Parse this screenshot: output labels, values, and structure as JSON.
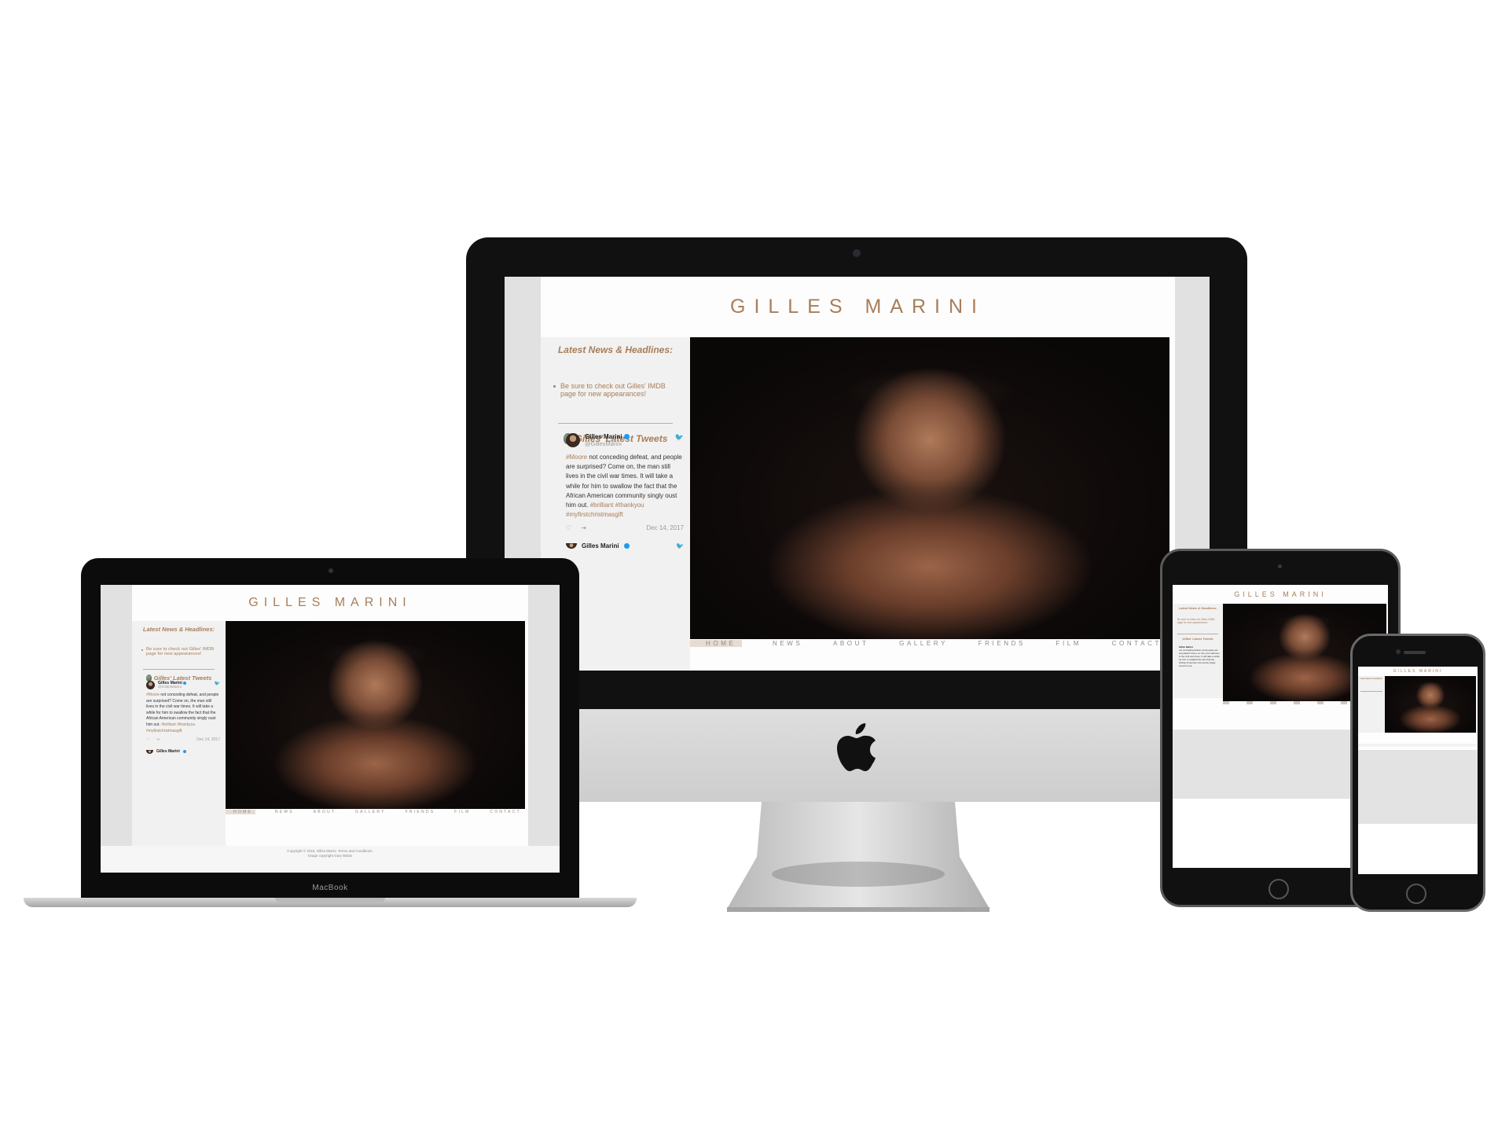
{
  "site": {
    "title": "GILLES MARINI",
    "news_heading": "Latest News & Headlines:",
    "news_items": [
      "Be sure to check out Gilles' IMDB page for new appearances!"
    ],
    "tweets_heading": "Gilles' Latest Tweets",
    "tweets": [
      {
        "name": "Gilles Marini",
        "handle": "@GillesMarini",
        "text_parts": [
          "#Moore",
          " not conceding defeat, and people are surprised? Come on, the man still lives in the civil war times. It will take a while for him to swallow the fact that the African American community singly oust him out. ",
          "#brilliant #thankyou #myfirstchristmasgift"
        ],
        "date": "Dec 14, 2017"
      },
      {
        "name": "Gilles Marini"
      }
    ],
    "nav": [
      "HOME",
      "NEWS",
      "ABOUT",
      "GALLERY",
      "FRIENDS",
      "FILM",
      "CONTACT"
    ],
    "active_nav": "HOME",
    "footer": [
      "Copyright © 2018, Gilles Marini. Terms and Conditions.",
      "Image copyright Gary Bisbis"
    ],
    "colors": {
      "accent": "#a87e58",
      "sidebar": "#f1f1f1",
      "gutter": "#e1e1e1"
    }
  },
  "devices": {
    "laptop_label": "MacBook",
    "icons": [
      "apple-logo-icon",
      "twitter-bird-icon",
      "heart-icon",
      "share-icon",
      "verified-badge-icon"
    ]
  }
}
